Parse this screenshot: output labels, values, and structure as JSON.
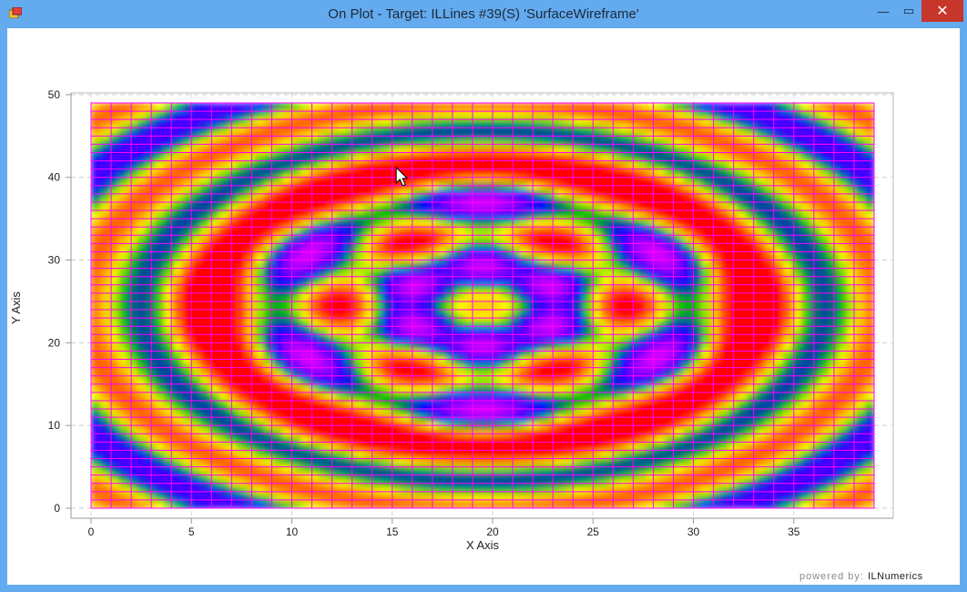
{
  "window": {
    "title": "On Plot - Target: ILLines #39(S) 'SurfaceWireframe'",
    "minimize_glyph": "—",
    "maximize_glyph": "▭",
    "close_glyph": "✕"
  },
  "chart_data": {
    "type": "heatmap",
    "xlabel": "X Axis",
    "ylabel": "Y Axis",
    "xlim": [
      0,
      39
    ],
    "ylim": [
      0,
      49
    ],
    "xticks": [
      "0",
      "5",
      "10",
      "15",
      "20",
      "25",
      "30",
      "35"
    ],
    "yticks": [
      "0",
      "10",
      "20",
      "30",
      "40",
      "50"
    ],
    "grid": true,
    "wireframe": true,
    "wireframe_color": "#ff00ff",
    "colormap": [
      "#ff00ff",
      "#8000ff",
      "#0000ff",
      "#00c000",
      "#ffff00",
      "#ff8000",
      "#ff0000"
    ],
    "cursor": {
      "x": 15.2,
      "y": 41.2
    }
  },
  "watermark": {
    "prefix": "powered by:",
    "brand": "ILNumerics"
  }
}
